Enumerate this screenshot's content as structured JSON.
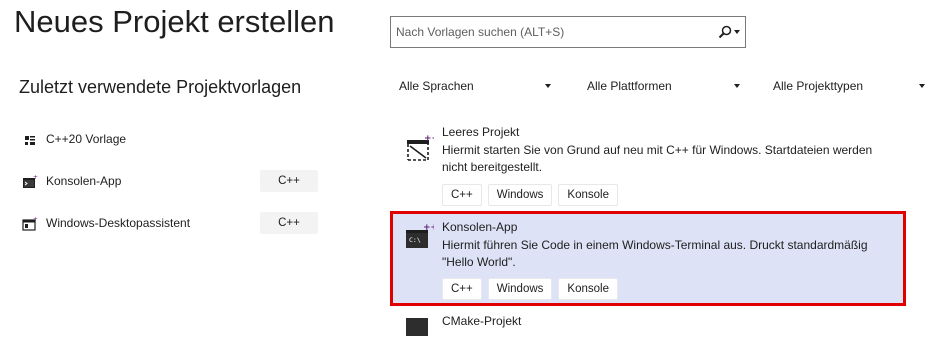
{
  "header": {
    "title": "Neues Projekt erstellen",
    "recent_title": "Zuletzt verwendete Projektvorlagen"
  },
  "search": {
    "placeholder": "Nach Vorlagen suchen (ALT+S)",
    "value": ""
  },
  "filters": [
    {
      "label": "Alle Sprachen"
    },
    {
      "label": "Alle Plattformen"
    },
    {
      "label": "Alle Projekttypen"
    }
  ],
  "recent": [
    {
      "label": "C++20 Vorlage",
      "icon": "cpp-template-icon",
      "lang": ""
    },
    {
      "label": "Konsolen-App",
      "icon": "console-app-icon",
      "lang": "C++"
    },
    {
      "label": "Windows-Desktopassistent",
      "icon": "desktop-wizard-icon",
      "lang": "C++"
    }
  ],
  "templates": [
    {
      "name": "Leeres Projekt",
      "description": "Hiermit starten Sie von Grund auf neu mit C++ für Windows. Startdateien werden nicht bereitgestellt.",
      "tags": [
        "C++",
        "Windows",
        "Konsole"
      ],
      "icon": "empty-project-icon",
      "selected": false
    },
    {
      "name": "Konsolen-App",
      "description": "Hiermit führen Sie Code in einem Windows-Terminal aus. Druckt standardmäßig \"Hello World\".",
      "tags": [
        "C++",
        "Windows",
        "Konsole"
      ],
      "icon": "console-app-icon",
      "selected": true
    },
    {
      "name": "CMake-Projekt",
      "icon": "cmake-project-icon",
      "selected": false
    }
  ],
  "colors": {
    "selection_bg": "#dde2f6",
    "highlight_border": "#e00000",
    "accent_plus": "#68217a"
  }
}
